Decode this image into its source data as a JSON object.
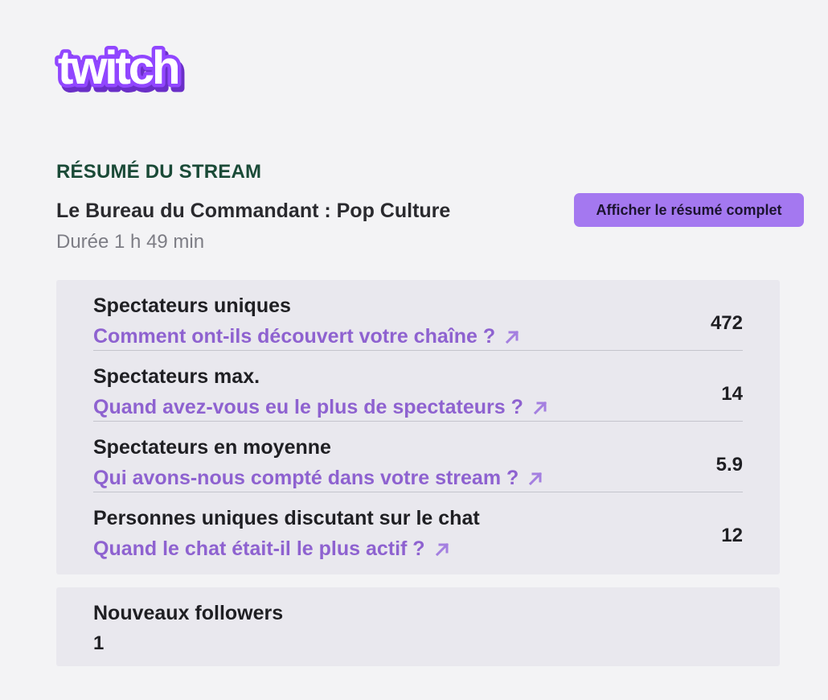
{
  "brand": {
    "logo_text": "twitch",
    "logo_color": "#9146ff"
  },
  "summary": {
    "section_title": "RÉSUMÉ DU STREAM",
    "stream_title": "Le Bureau du Commandant : Pop Culture",
    "duration": "Durée 1 h 49 min",
    "full_summary_button": "Afficher le résumé complet"
  },
  "stats": [
    {
      "label": "Spectateurs uniques",
      "link": "Comment ont-ils découvert votre chaîne ?",
      "value": "472"
    },
    {
      "label": "Spectateurs max.",
      "link": "Quand avez-vous eu le plus de spectateurs ?",
      "value": "14"
    },
    {
      "label": "Spectateurs en moyenne",
      "link": "Qui avons-nous compté dans votre stream ?",
      "value": "5.9"
    },
    {
      "label": "Personnes uniques discutant sur le chat",
      "link": "Quand le chat était-il le plus actif ?",
      "value": "12"
    }
  ],
  "followers": {
    "label": "Nouveaux followers",
    "value": "1"
  },
  "colors": {
    "accent": "#a478f0",
    "link": "#8e62d0",
    "section_title": "#1a4a37",
    "card_background": "#e9e8ee",
    "page_background": "#f3f3f5"
  },
  "icons": {
    "external_link": "arrow-up-right-icon"
  }
}
